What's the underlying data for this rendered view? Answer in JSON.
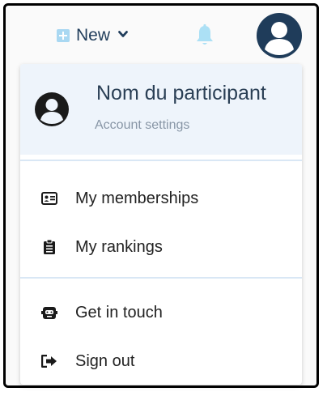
{
  "topbar": {
    "new_label": "New",
    "new_icon": "plus-square-icon",
    "chevron_icon": "chevron-down-icon",
    "bell_icon": "bell-icon",
    "avatar_icon": "user-circle-icon"
  },
  "menu": {
    "participant_name": "Nom du participant",
    "account_settings": "Account settings",
    "items": [
      {
        "label": "My memberships",
        "icon": "id-card-icon"
      },
      {
        "label": "My rankings",
        "icon": "clipboard-list-icon"
      },
      {
        "label": "Get in touch",
        "icon": "headset-icon"
      },
      {
        "label": "Sign out",
        "icon": "sign-out-icon"
      }
    ]
  },
  "colors": {
    "navy": "#1f3c5a",
    "accent_light": "#a9d8f2",
    "header_bg": "#eef4fb",
    "divider": "#d9e7f5",
    "muted_text": "#8896a6"
  }
}
